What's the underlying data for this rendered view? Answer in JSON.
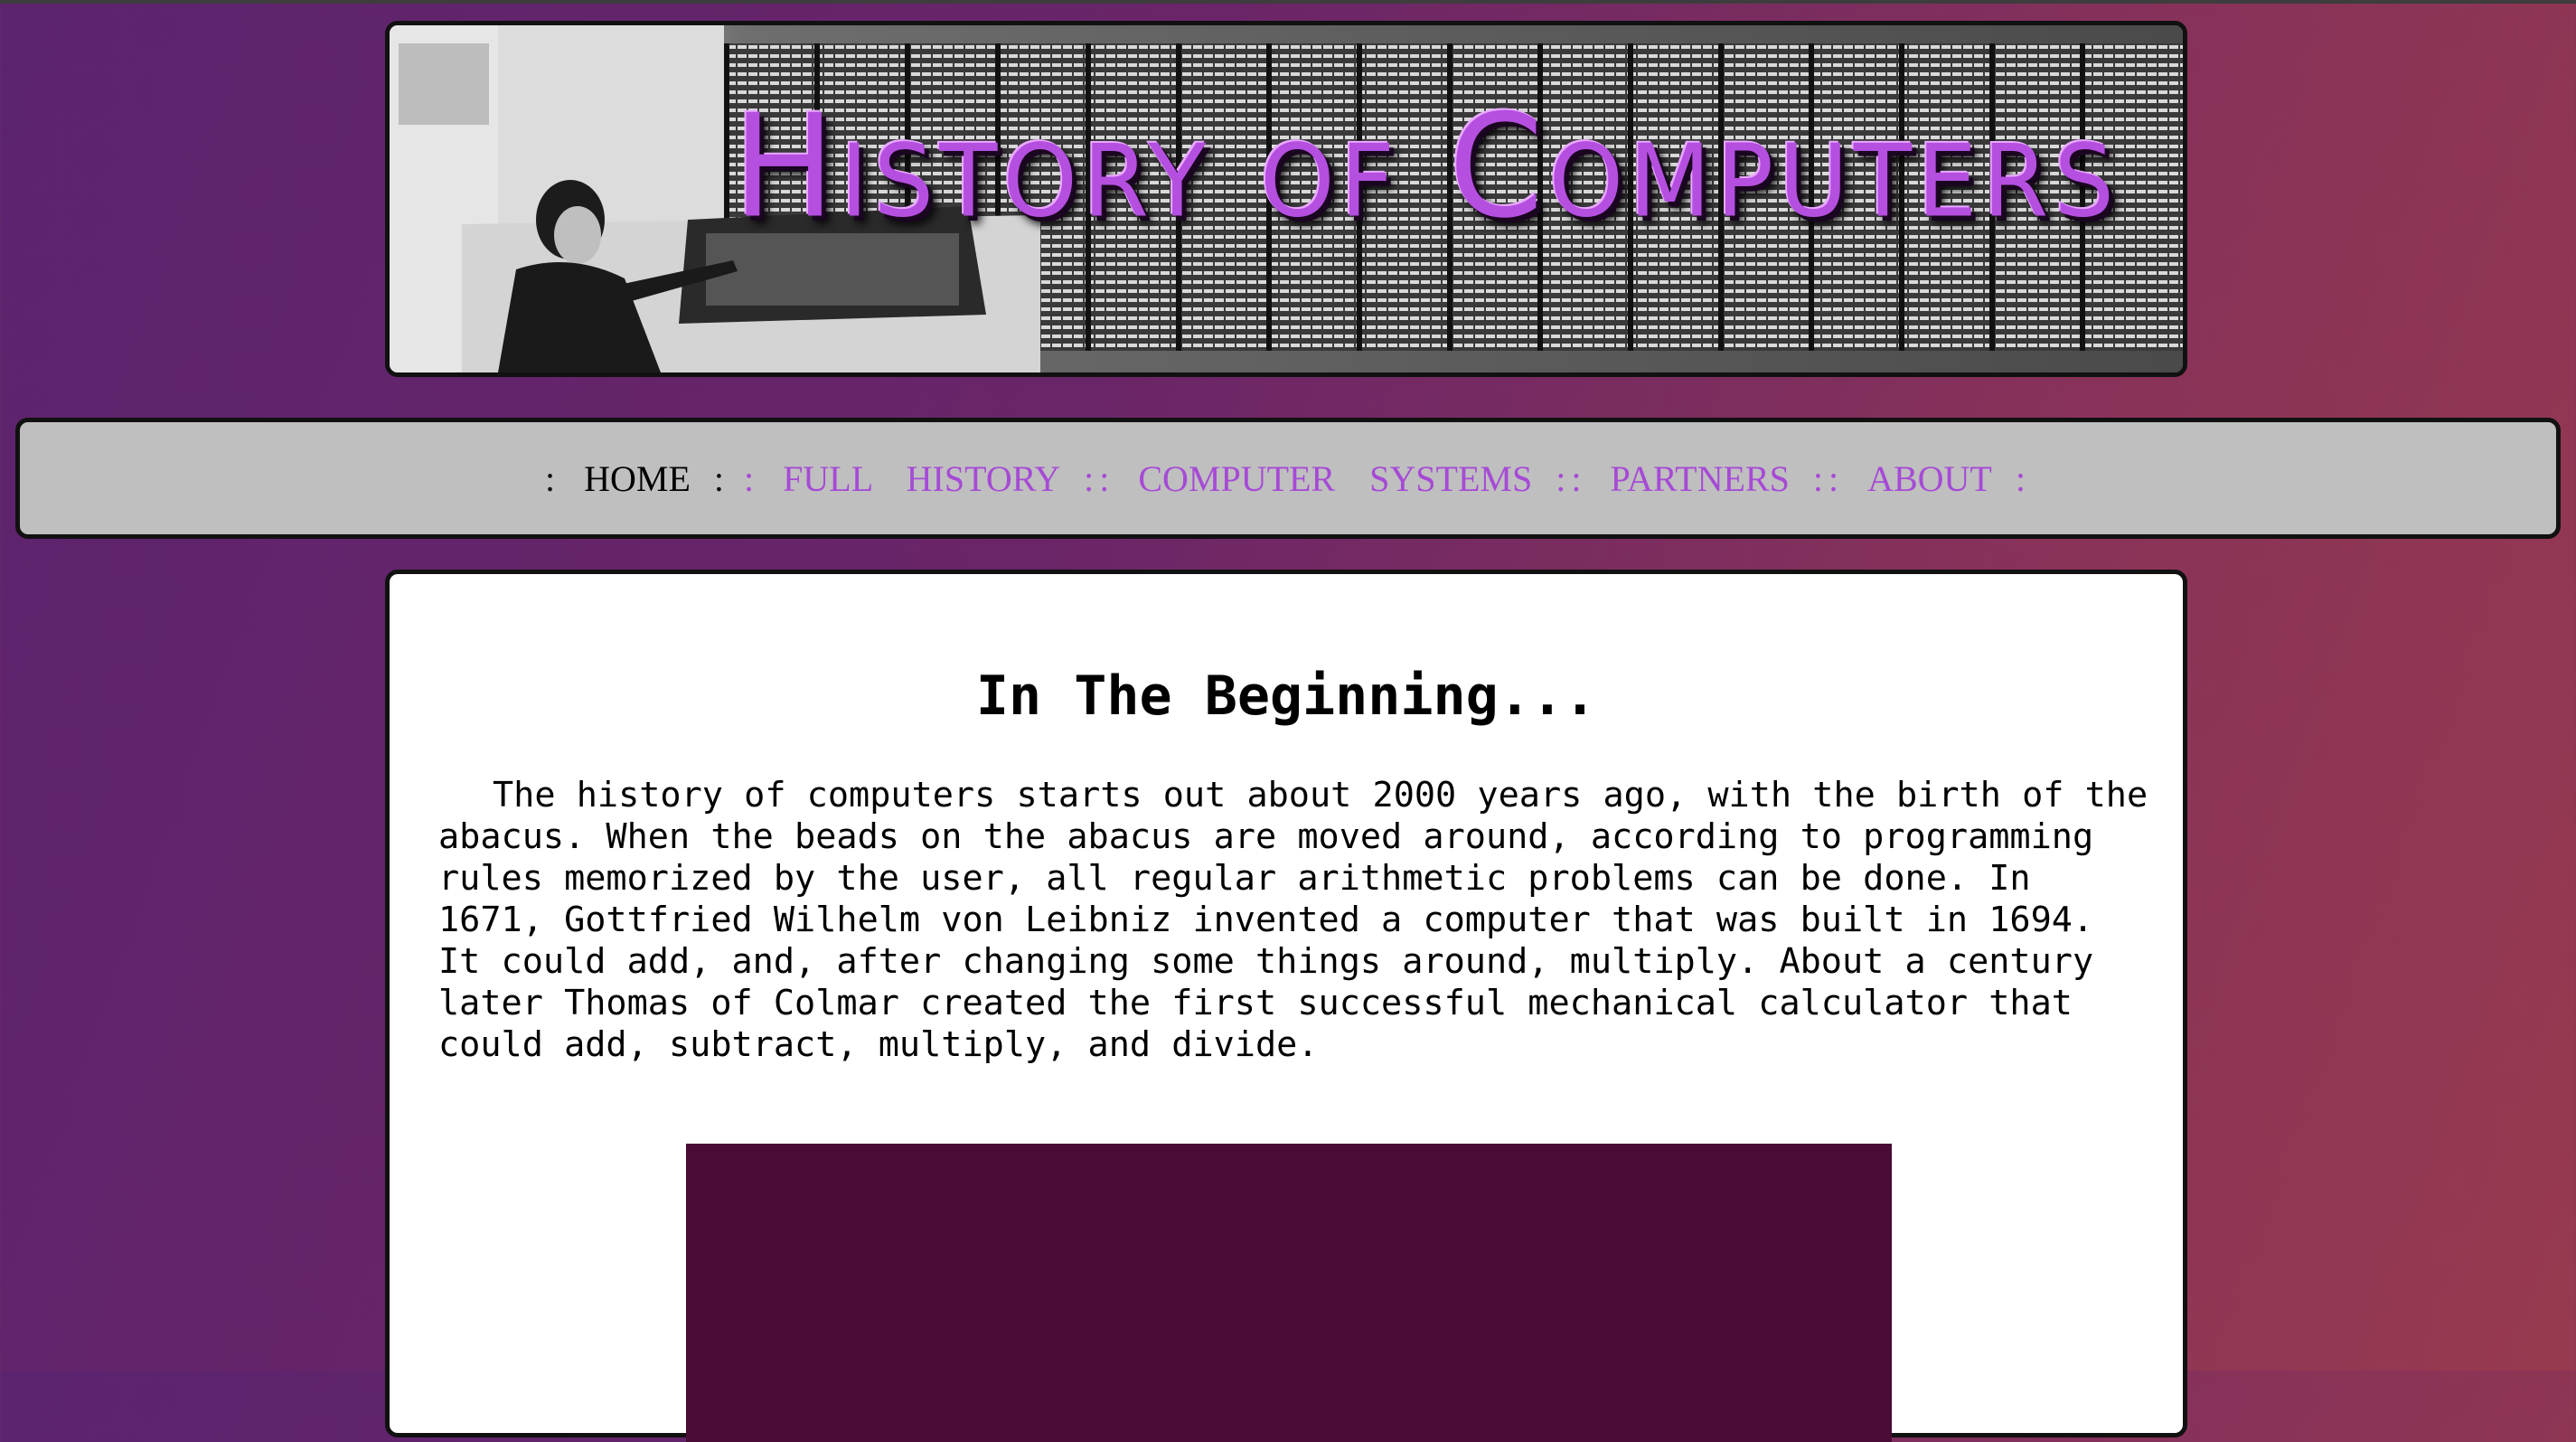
{
  "banner": {
    "title": "History of Computers",
    "image_icon": "vintage-computer-room-photo"
  },
  "nav": {
    "items": [
      {
        "label": "HOME",
        "active": true
      },
      {
        "label": "FULL HISTORY",
        "active": false
      },
      {
        "label": "COMPUTER SYSTEMS",
        "active": false
      },
      {
        "label": "PARTNERS",
        "active": false
      },
      {
        "label": "ABOUT",
        "active": false
      }
    ],
    "active_color": "#000000",
    "link_color": "#a64ad6"
  },
  "content": {
    "heading": "In The Beginning...",
    "paragraph": "The history of computers starts out about 2000 years ago, with the birth of the abacus. When the beads on the abacus are moved around, according to programming rules memorized by the user, all regular arithmetic problems can be done. In 1671, Gottfried Wilhelm von Leibniz invented a computer that was built in 1694. It could add, and, after changing some things around, multiply. About a century later Thomas of Colmar created the first successful mechanical calculator that could add, subtract, multiply, and divide."
  },
  "colors": {
    "background_start": "#5c236e",
    "background_end": "#973a4f",
    "nav_background": "#bfbfbf",
    "media_background": "#4a0b36"
  }
}
